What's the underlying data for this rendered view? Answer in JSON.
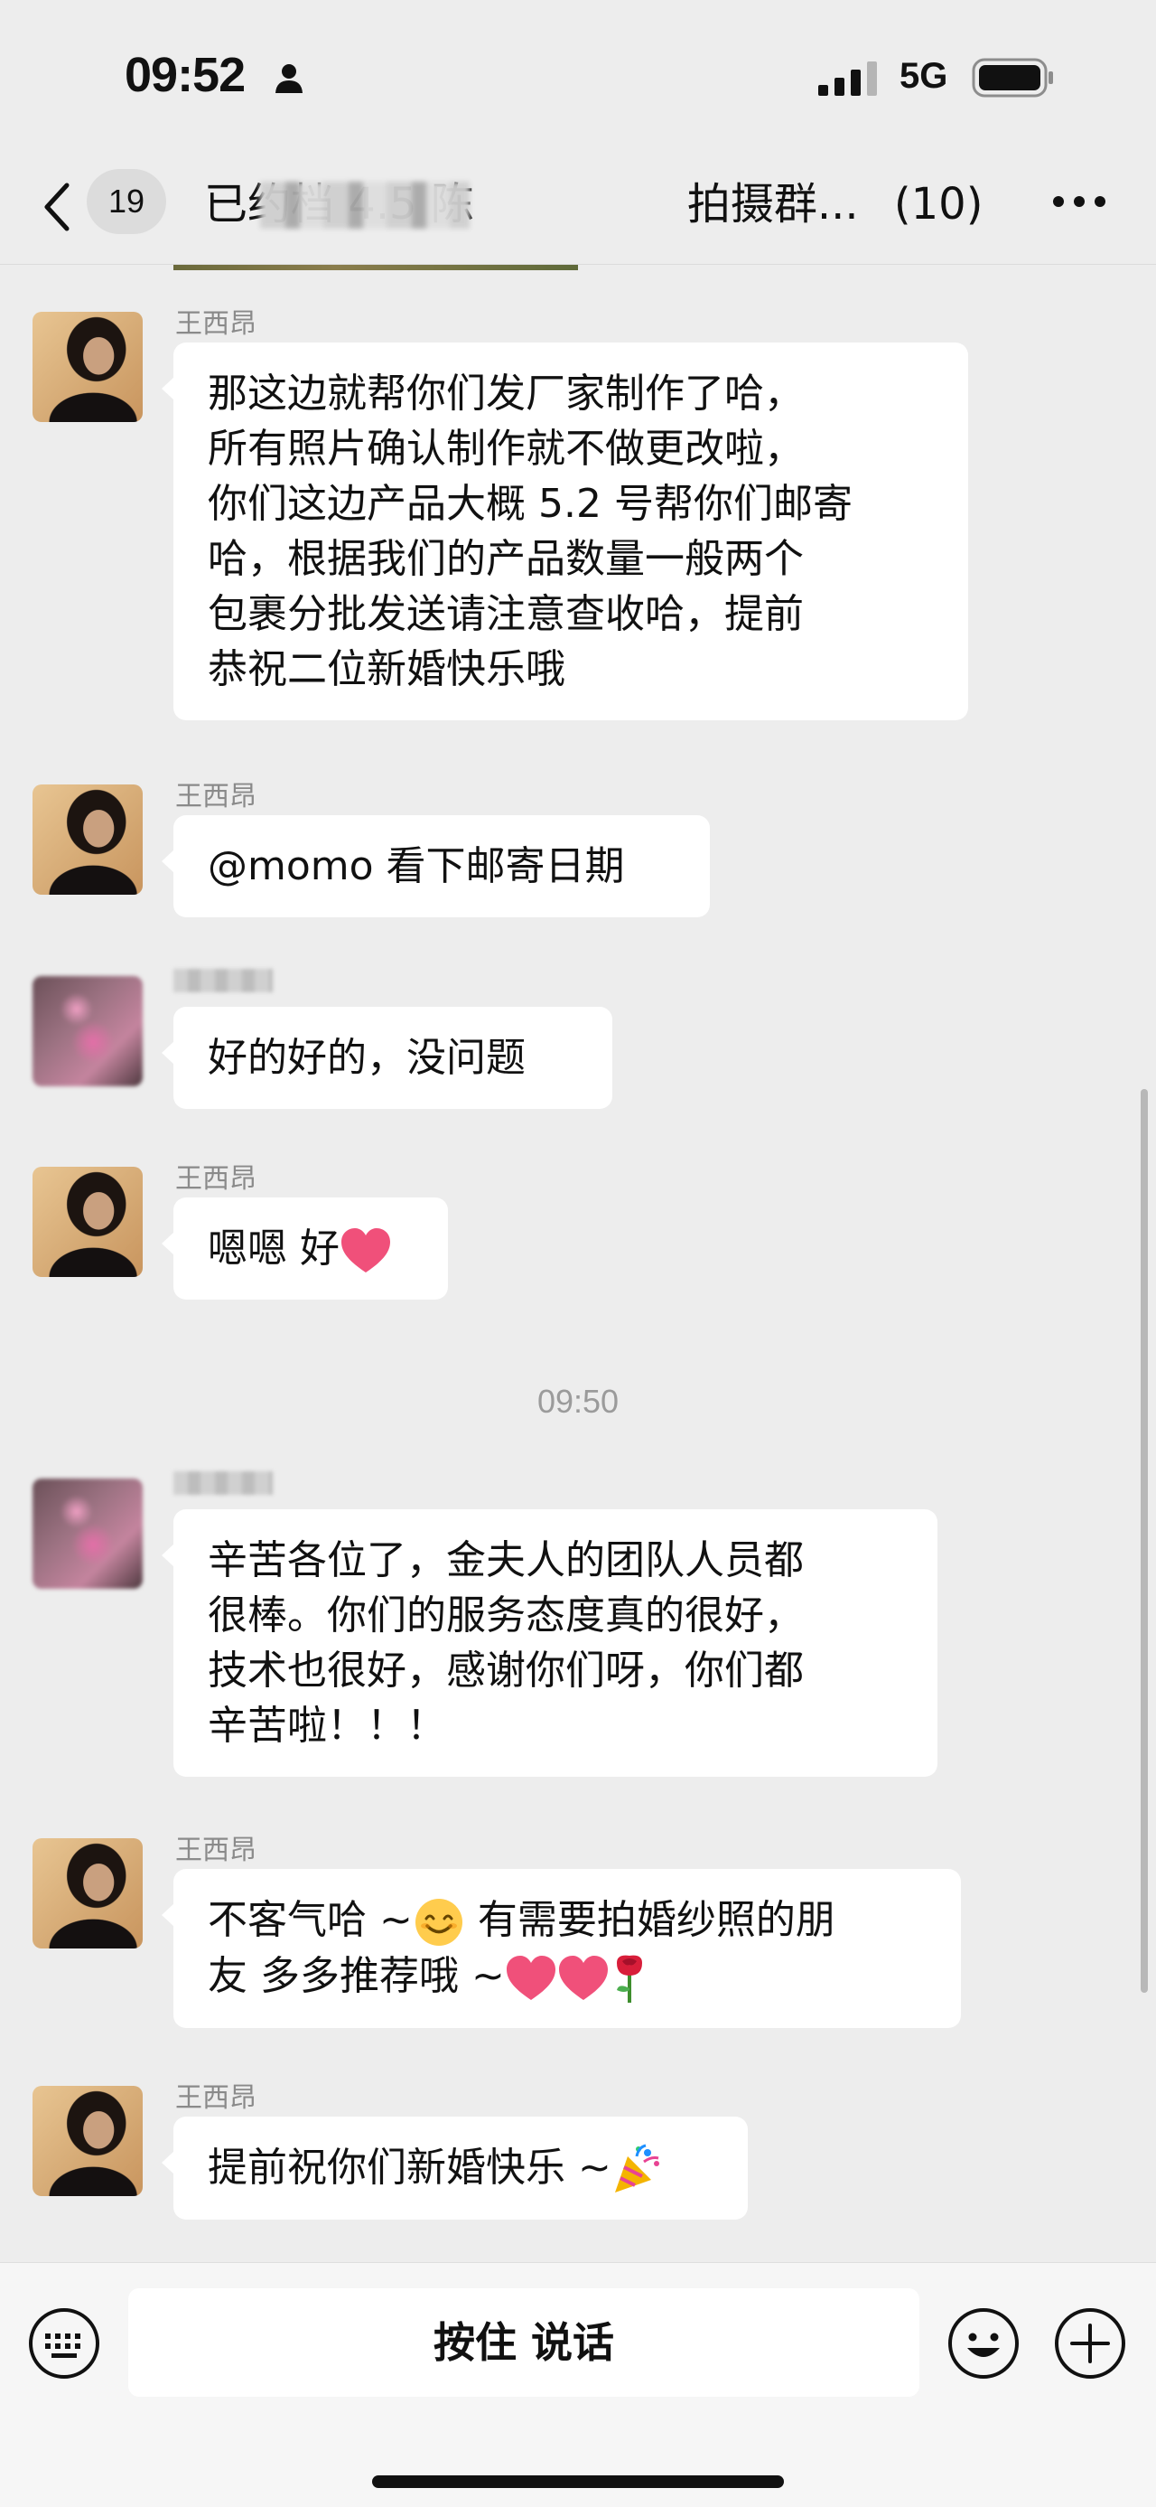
{
  "status_bar": {
    "time": "09:52",
    "network": "5G",
    "icons": [
      "person-icon",
      "signal-bars-icon",
      "battery-icon"
    ]
  },
  "nav": {
    "back_icon": "chevron-left-icon",
    "unread_count": "19",
    "title_prefix": "已约档 4.5 陈",
    "title_suffix": "拍摄群...",
    "member_count": "(10)",
    "more_icon": "ellipsis-icon"
  },
  "messages": [
    {
      "sender": "王西昂",
      "avatar": "man",
      "lines": [
        "那这边就帮你们发厂家制作了哈，",
        "所有照片确认制作就不做更改啦，",
        "你们这边产品大概 5.2 号帮你们邮寄",
        "哈，根据我们的产品数量一般两个",
        "包裹分批发送请注意查收哈，提前",
        "恭祝二位新婚快乐哦"
      ]
    },
    {
      "sender": "王西昂",
      "avatar": "man",
      "lines": [
        "@momo  看下邮寄日期"
      ]
    },
    {
      "sender": "",
      "avatar": "blur",
      "lines": [
        "好的好的，没问题"
      ]
    },
    {
      "sender": "王西昂",
      "avatar": "man",
      "lines": [
        "嗯嗯 好"
      ],
      "trailing_emoji": "heart-icon"
    },
    {
      "sender": "",
      "avatar": "blur",
      "lines": [
        "辛苦各位了，金夫人的团队人员都",
        "很棒。你们的服务态度真的很好，",
        "技术也很好，感谢你们呀，你们都",
        "辛苦啦！！！"
      ]
    },
    {
      "sender": "王西昂",
      "avatar": "man",
      "line1_a": "不客气哈 ~",
      "line1_b": "  有需要拍婚纱照的朋",
      "line2_a": "友 多多推荐哦 ~",
      "emojis": [
        "smile-emoji-icon",
        "heart-icon",
        "heart-icon",
        "rose-icon"
      ]
    },
    {
      "sender": "王西昂",
      "avatar": "man",
      "line1_a": "提前祝你们新婚快乐 ~",
      "emojis": [
        "party-popper-icon"
      ]
    }
  ],
  "timestamp": "09:50",
  "input_bar": {
    "voice_label": "按住 说话",
    "left_icon": "keyboard-icon",
    "emoji_icon": "smiley-icon",
    "plus_icon": "plus-circle-icon"
  },
  "colors": {
    "background": "#ededed",
    "bubble": "#ffffff",
    "heart": "#f0507a"
  }
}
